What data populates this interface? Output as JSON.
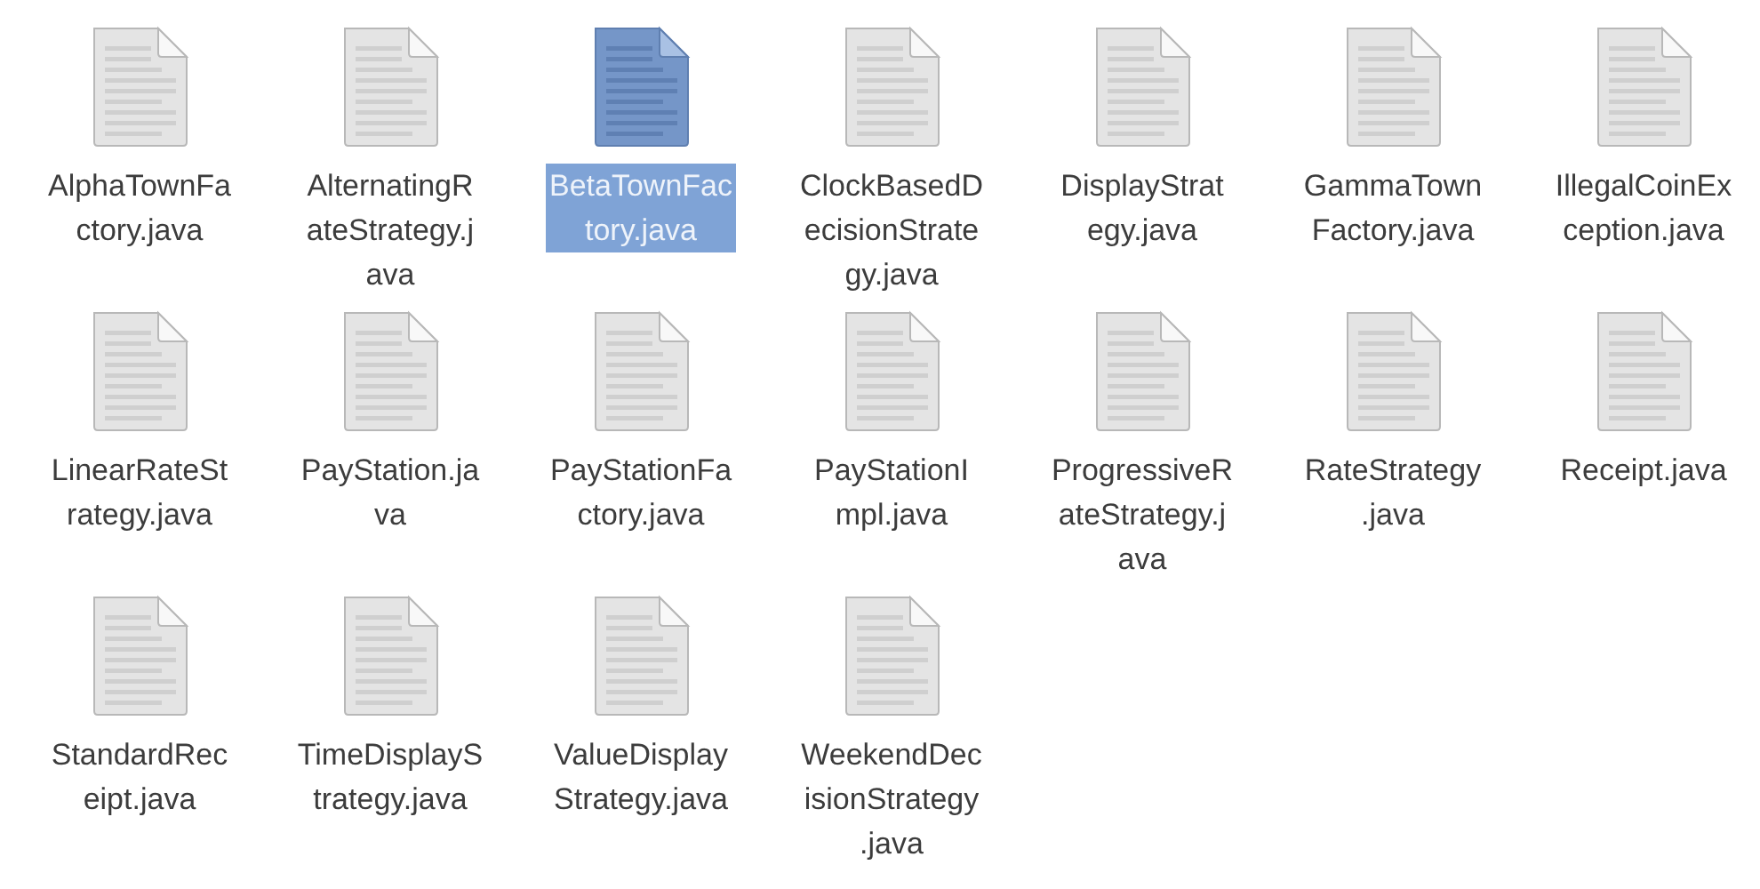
{
  "files": [
    {
      "lines": [
        "AlphaTownFa",
        "ctory.java"
      ],
      "selected": false
    },
    {
      "lines": [
        "AlternatingR",
        "ateStrategy.j",
        "ava"
      ],
      "selected": false
    },
    {
      "lines": [
        "BetaTownFac",
        "tory.java"
      ],
      "selected": true
    },
    {
      "lines": [
        "ClockBasedD",
        "ecisionStrate",
        "gy.java"
      ],
      "selected": false
    },
    {
      "lines": [
        "DisplayStrat",
        "egy.java"
      ],
      "selected": false
    },
    {
      "lines": [
        "GammaTown",
        "Factory.java"
      ],
      "selected": false
    },
    {
      "lines": [
        "IllegalCoinEx",
        "ception.java"
      ],
      "selected": false
    },
    {
      "lines": [
        "LinearRateSt",
        "rategy.java"
      ],
      "selected": false
    },
    {
      "lines": [
        "PayStation.ja",
        "va"
      ],
      "selected": false
    },
    {
      "lines": [
        "PayStationFa",
        "ctory.java"
      ],
      "selected": false
    },
    {
      "lines": [
        "PayStationI",
        "mpl.java"
      ],
      "selected": false
    },
    {
      "lines": [
        "ProgressiveR",
        "ateStrategy.j",
        "ava"
      ],
      "selected": false
    },
    {
      "lines": [
        "RateStrategy",
        ".java"
      ],
      "selected": false
    },
    {
      "lines": [
        "Receipt.java"
      ],
      "selected": false
    },
    {
      "lines": [
        "StandardRec",
        "eipt.java"
      ],
      "selected": false
    },
    {
      "lines": [
        "TimeDisplayS",
        "trategy.java"
      ],
      "selected": false
    },
    {
      "lines": [
        "ValueDisplay",
        "Strategy.java"
      ],
      "selected": false
    },
    {
      "lines": [
        "WeekendDec",
        "isionStrategy",
        ".java"
      ],
      "selected": false
    }
  ]
}
